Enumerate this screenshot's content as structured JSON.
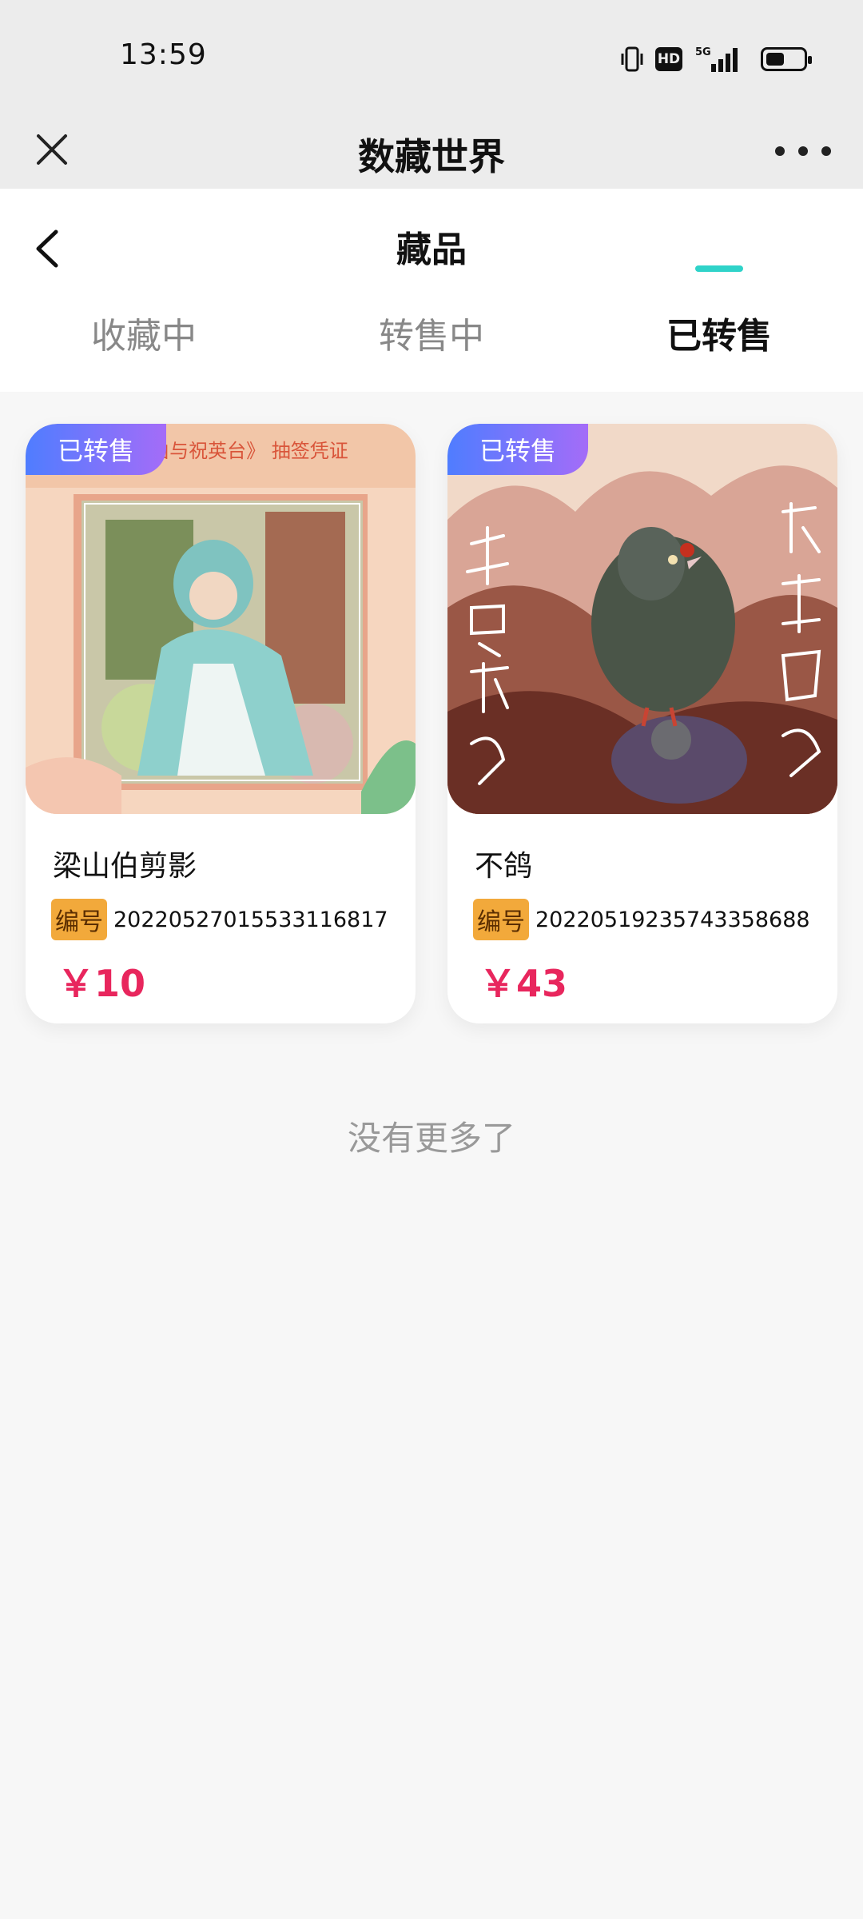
{
  "status": {
    "time": "13:59",
    "hd": "HD",
    "network": "5G"
  },
  "navbar": {
    "title": "数藏世界"
  },
  "page": {
    "title": "藏品"
  },
  "tabs": [
    {
      "label": "收藏中"
    },
    {
      "label": "转售中"
    },
    {
      "label": "已转售",
      "active": true
    }
  ],
  "cards": [
    {
      "badge": "已转售",
      "image_caption": "《梁山伯与祝英台》 抽签凭证",
      "name": "梁山伯剪影",
      "id_label": "编号",
      "id_number": "20220527015533116817",
      "price": "￥10"
    },
    {
      "badge": "已转售",
      "name": "不鸽",
      "id_label": "编号",
      "id_number": "20220519235743358688",
      "price": "￥43"
    }
  ],
  "footer": {
    "no_more": "没有更多了"
  },
  "colors": {
    "accent": "#2fd3c9",
    "price": "#e8265d",
    "badge_start": "#4f7dff",
    "badge_end": "#a46cf8",
    "id_tag": "#f2a93b"
  }
}
